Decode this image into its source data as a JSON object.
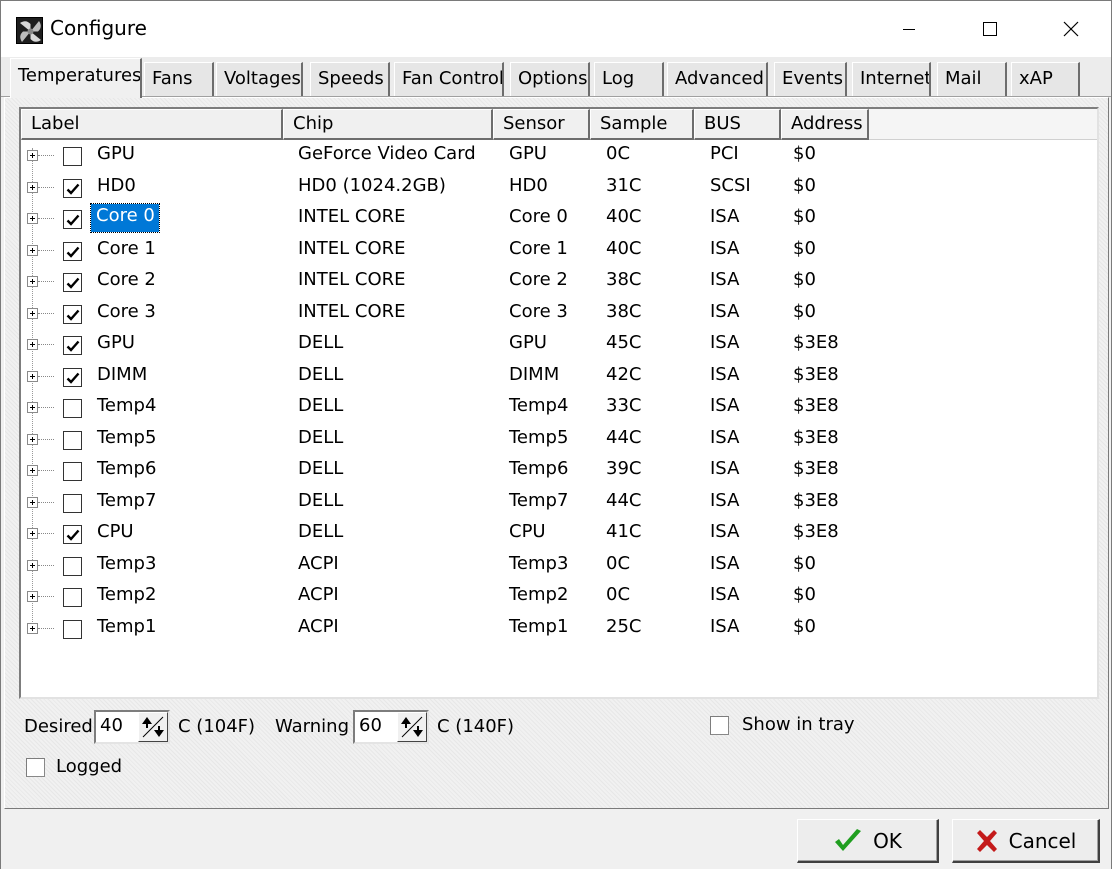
{
  "window": {
    "title": "Configure",
    "icon": "app-fan-icon"
  },
  "tabs": [
    {
      "label": "Temperatures",
      "active": true
    },
    {
      "label": "Fans",
      "active": false
    },
    {
      "label": "Voltages",
      "active": false
    },
    {
      "label": "Speeds",
      "active": false
    },
    {
      "label": "Fan Control",
      "active": false
    },
    {
      "label": "Options",
      "active": false
    },
    {
      "label": "Log",
      "active": false
    },
    {
      "label": "Advanced",
      "active": false
    },
    {
      "label": "Events",
      "active": false
    },
    {
      "label": "Internet",
      "active": false
    },
    {
      "label": "Mail",
      "active": false
    },
    {
      "label": "xAP",
      "active": false
    }
  ],
  "table": {
    "columns": [
      "Label",
      "Chip",
      "Sensor",
      "Sample",
      "BUS",
      "Address"
    ],
    "rows": [
      {
        "checked": false,
        "label": "GPU",
        "chip": "GeForce Video Card",
        "sensor": "GPU",
        "sample": "0C",
        "bus": "PCI",
        "address": "$0"
      },
      {
        "checked": true,
        "label": "HD0",
        "chip": "HD0 (1024.2GB)",
        "sensor": "HD0",
        "sample": "31C",
        "bus": "SCSI",
        "address": "$0"
      },
      {
        "checked": true,
        "label": "Core 0",
        "chip": "INTEL CORE",
        "sensor": "Core 0",
        "sample": "40C",
        "bus": "ISA",
        "address": "$0",
        "selected": true
      },
      {
        "checked": true,
        "label": "Core 1",
        "chip": "INTEL CORE",
        "sensor": "Core 1",
        "sample": "40C",
        "bus": "ISA",
        "address": "$0"
      },
      {
        "checked": true,
        "label": "Core 2",
        "chip": "INTEL CORE",
        "sensor": "Core 2",
        "sample": "38C",
        "bus": "ISA",
        "address": "$0"
      },
      {
        "checked": true,
        "label": "Core 3",
        "chip": "INTEL CORE",
        "sensor": "Core 3",
        "sample": "38C",
        "bus": "ISA",
        "address": "$0"
      },
      {
        "checked": true,
        "label": "GPU",
        "chip": "DELL",
        "sensor": "GPU",
        "sample": "45C",
        "bus": "ISA",
        "address": "$3E8"
      },
      {
        "checked": true,
        "label": "DIMM",
        "chip": "DELL",
        "sensor": "DIMM",
        "sample": "42C",
        "bus": "ISA",
        "address": "$3E8"
      },
      {
        "checked": false,
        "label": "Temp4",
        "chip": "DELL",
        "sensor": "Temp4",
        "sample": "33C",
        "bus": "ISA",
        "address": "$3E8"
      },
      {
        "checked": false,
        "label": "Temp5",
        "chip": "DELL",
        "sensor": "Temp5",
        "sample": "44C",
        "bus": "ISA",
        "address": "$3E8"
      },
      {
        "checked": false,
        "label": "Temp6",
        "chip": "DELL",
        "sensor": "Temp6",
        "sample": "39C",
        "bus": "ISA",
        "address": "$3E8"
      },
      {
        "checked": false,
        "label": "Temp7",
        "chip": "DELL",
        "sensor": "Temp7",
        "sample": "44C",
        "bus": "ISA",
        "address": "$3E8"
      },
      {
        "checked": true,
        "label": "CPU",
        "chip": "DELL",
        "sensor": "CPU",
        "sample": "41C",
        "bus": "ISA",
        "address": "$3E8"
      },
      {
        "checked": false,
        "label": "Temp3",
        "chip": "ACPI",
        "sensor": "Temp3",
        "sample": "0C",
        "bus": "ISA",
        "address": "$0"
      },
      {
        "checked": false,
        "label": "Temp2",
        "chip": "ACPI",
        "sensor": "Temp2",
        "sample": "0C",
        "bus": "ISA",
        "address": "$0"
      },
      {
        "checked": false,
        "label": "Temp1",
        "chip": "ACPI",
        "sensor": "Temp1",
        "sample": "25C",
        "bus": "ISA",
        "address": "$0"
      }
    ]
  },
  "controls": {
    "desired_label": "Desired",
    "desired_value": "40",
    "desired_unit": "C (104F)",
    "warning_label": "Warning",
    "warning_value": "60",
    "warning_unit": "C (140F)",
    "show_in_tray_label": "Show in tray",
    "show_in_tray_checked": false,
    "logged_label": "Logged",
    "logged_checked": false
  },
  "buttons": {
    "ok_label": "OK",
    "cancel_label": "Cancel"
  },
  "colors": {
    "selection": "#0078d7",
    "ok_check": "#1f9e1f",
    "cancel_x": "#c41a1a"
  }
}
